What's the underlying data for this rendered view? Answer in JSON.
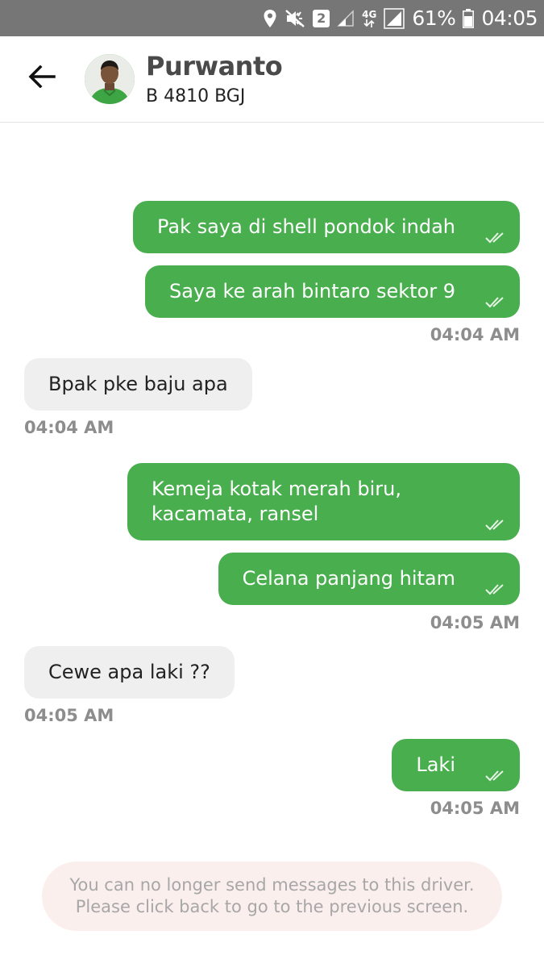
{
  "status_bar": {
    "sim_slot": "2",
    "network_type": "4G",
    "battery": "61%",
    "time": "04:05",
    "icons": [
      "location-icon",
      "mute-icon",
      "sim-icon",
      "signal-icon",
      "data-icon",
      "signal-full-icon",
      "battery-icon"
    ]
  },
  "header": {
    "back_icon": "back-arrow-icon",
    "driver_name": "Purwanto",
    "plate": "B 4810 BGJ"
  },
  "colors": {
    "accent": "#49ae4e",
    "status_bar": "#767676",
    "incoming_bubble": "#efefef",
    "timestamp": "#8d8d8d",
    "notice_bg": "#fbefed"
  },
  "messages": [
    {
      "direction": "out",
      "text": "Pak saya di shell pondok indah",
      "status": "read"
    },
    {
      "direction": "out",
      "text": "Saya ke arah bintaro sektor 9",
      "status": "read",
      "time": "04:04 AM"
    },
    {
      "direction": "in",
      "text": "Bpak pke baju apa",
      "time": "04:04 AM"
    },
    {
      "direction": "out",
      "lines": [
        "Kemeja kotak merah biru,",
        "kacamata, ransel"
      ],
      "status": "read"
    },
    {
      "direction": "out",
      "text": "Celana panjang hitam",
      "status": "read",
      "time": "04:05 AM"
    },
    {
      "direction": "in",
      "text": "Cewe apa laki ??",
      "time": "04:05 AM"
    },
    {
      "direction": "out",
      "text": "Laki",
      "status": "read",
      "time": "04:05 AM"
    }
  ],
  "notice": {
    "line1": "You can no longer send messages to this driver.",
    "line2": "Please click back to go to the previous screen."
  }
}
